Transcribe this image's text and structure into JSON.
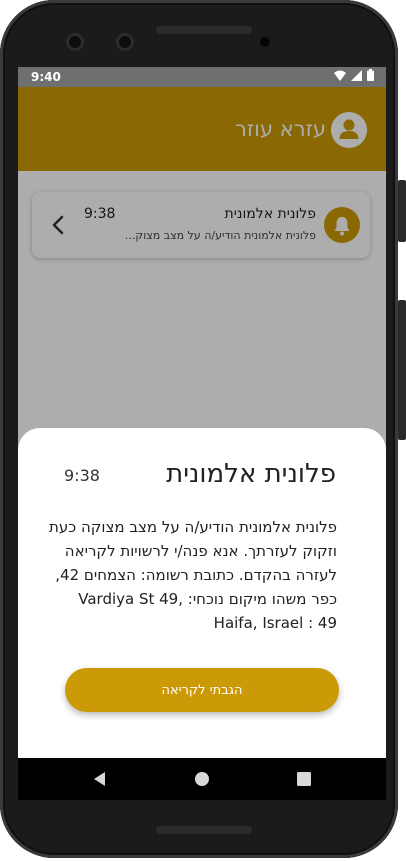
{
  "status_bar": {
    "time": "9:40",
    "icons": [
      "wifi-icon",
      "signal-icon",
      "battery-icon"
    ]
  },
  "app_bar": {
    "title": "עזרא עוזר",
    "icon": "user-avatar-icon",
    "color": "#cc9a06"
  },
  "notification": {
    "name": "פלונית אלמונית",
    "time": "9:38",
    "preview": "פלונית אלמונית הודיע/ה על מצב מצוק...",
    "icon": "bell-icon",
    "chevron_icon": "chevron-left-icon"
  },
  "dialog": {
    "title": "פלונית אלמונית",
    "time": "9:38",
    "body": "פלונית אלמונית הודיע/ה על מצב מצוקה כעת וזקוק לעזרתך. אנא פנה/י לרשויות לקריאה לעזרה בהקדם. כתובת רשומה: הצמחים 42, כפר משהו מיקום נוכחי: Vardiya St 49, Haifa, Israel : 49",
    "button_label": "הגבתי לקריאה"
  },
  "nav_bar": {
    "icons": [
      "back-icon",
      "home-icon",
      "recents-icon"
    ]
  },
  "colors": {
    "accent": "#cc9a06",
    "scrim": "rgba(0,0,0,0.32)"
  }
}
